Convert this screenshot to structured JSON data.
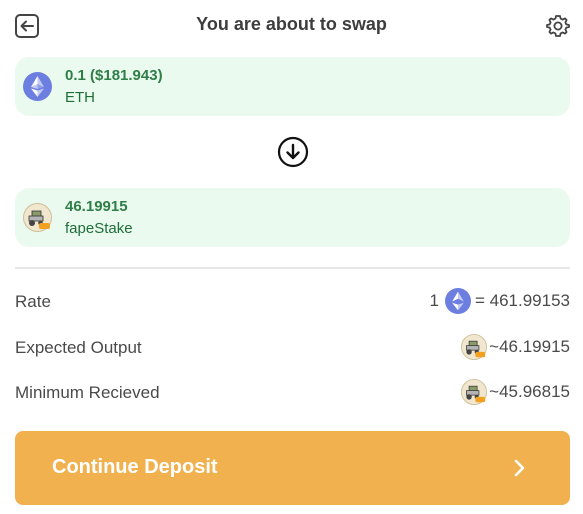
{
  "header": {
    "title": "You are about to swap",
    "back_icon": "back-arrow-icon",
    "settings_icon": "gear-icon"
  },
  "from_token": {
    "amount": "0.1 ($181.943)",
    "symbol": "ETH",
    "icon": "ethereum-icon"
  },
  "to_token": {
    "amount": "46.19915",
    "symbol": "fapeStake",
    "icon": "fapestake-token-icon"
  },
  "details": {
    "rate": {
      "label": "Rate",
      "prefix": "1",
      "value": "= 461.99153"
    },
    "expected_output": {
      "label": "Expected Output",
      "value": "~46.19915"
    },
    "minimum_received": {
      "label": "Minimum Recieved",
      "value": "~45.96815"
    }
  },
  "cta": {
    "label": "Continue Deposit",
    "icon": "chevron-right-icon"
  },
  "colors": {
    "card_bg": "#eafaee",
    "amount_green": "#2f7d47",
    "cta_orange": "#f2b14f",
    "eth_purple": "#6c7ee0"
  }
}
